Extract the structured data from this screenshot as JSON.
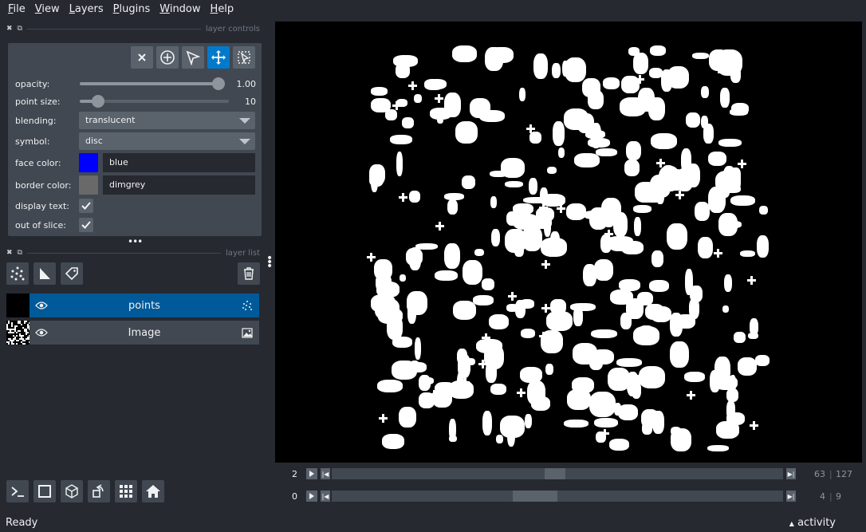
{
  "menu": [
    {
      "key": "F",
      "rest": "ile"
    },
    {
      "key": "V",
      "rest": "iew"
    },
    {
      "key": "L",
      "rest": "ayers"
    },
    {
      "key": "P",
      "rest": "lugins"
    },
    {
      "key": "W",
      "rest": "indow"
    },
    {
      "key": "H",
      "rest": "elp"
    }
  ],
  "layer_controls": {
    "title": "layer controls",
    "opacity_label": "opacity:",
    "opacity_value": "1.00",
    "opacity_fraction": 1.0,
    "point_size_label": "point size:",
    "point_size_value": "10",
    "point_size_fraction": 0.05,
    "blending_label": "blending:",
    "blending_value": "translucent",
    "symbol_label": "symbol:",
    "symbol_value": "disc",
    "face_color_label": "face color:",
    "face_color_value": "blue",
    "face_color_hex": "#0000ff",
    "border_color_label": "border color:",
    "border_color_value": "dimgrey",
    "border_color_hex": "#696969",
    "display_text_label": "display text:",
    "out_of_slice_label": "out of slice:"
  },
  "layer_list": {
    "title": "layer list",
    "layers": [
      {
        "name": "points",
        "selected": true,
        "type_icon": "points-icon"
      },
      {
        "name": "Image",
        "selected": false,
        "type_icon": "image-icon"
      }
    ]
  },
  "dims": [
    {
      "label": "2",
      "current": "63",
      "max": "127",
      "position_fraction": 0.49
    },
    {
      "label": "0",
      "current": "4",
      "max": "9",
      "position_fraction": 0.44
    }
  ],
  "status": {
    "text": "Ready",
    "activity_label": "activity"
  },
  "colors": {
    "accent": "#007acc",
    "background": "#262930",
    "panel": "#414851"
  }
}
